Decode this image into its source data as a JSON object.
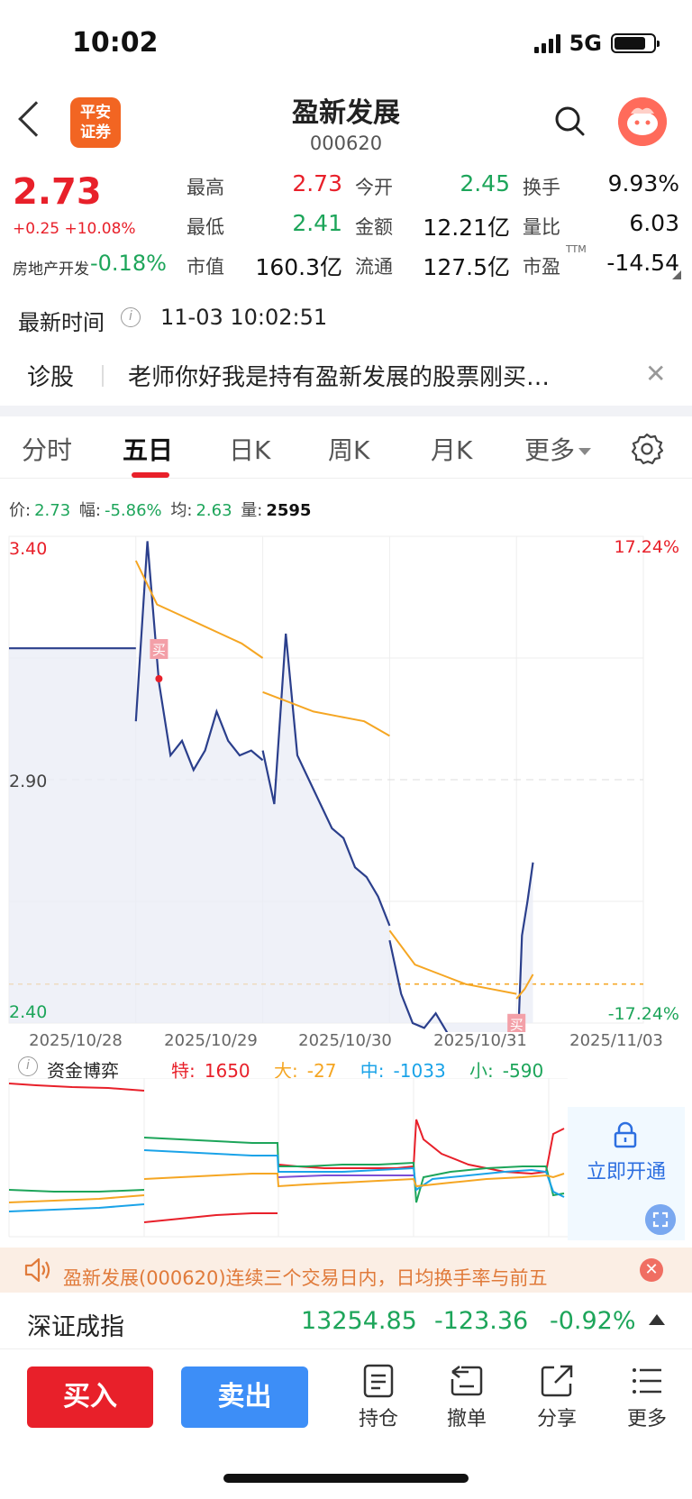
{
  "status_bar": {
    "time": "10:02",
    "network": "5G"
  },
  "header": {
    "logo_line1": "平安",
    "logo_line2": "证券",
    "stock_name": "盈新发展",
    "stock_code": "000620"
  },
  "quote": {
    "price": "2.73",
    "change": "+0.25 +10.08%",
    "sector_name": "房地产开发",
    "sector_change": "-0.18%",
    "fields": [
      {
        "label": "最高",
        "value": "2.73"
      },
      {
        "label": "今开",
        "value": "2.45"
      },
      {
        "label": "换手",
        "value": "9.93%"
      },
      {
        "label": "最低",
        "value": "2.41"
      },
      {
        "label": "金额",
        "value": "12.21亿"
      },
      {
        "label": "量比",
        "value": "6.03"
      },
      {
        "label": "市值",
        "value": "160.3亿"
      },
      {
        "label": "流通",
        "value": "127.5亿"
      },
      {
        "label": "市盈",
        "value": "-14.54",
        "superscript": "TTM"
      }
    ]
  },
  "latest": {
    "label": "最新时间",
    "time": "11-03 10:02:51"
  },
  "diagnosis": {
    "label": "诊股",
    "text": "老师你好我是持有盈新发展的股票刚买…"
  },
  "tabs": [
    {
      "label": "分时"
    },
    {
      "label": "五日"
    },
    {
      "label": "日K"
    },
    {
      "label": "周K"
    },
    {
      "label": "月K"
    },
    {
      "label": "更多"
    }
  ],
  "active_tab": "五日",
  "info_line": {
    "price_label": "价:",
    "price": "2.73",
    "range_label": "幅:",
    "range": "-5.86%",
    "avg_label": "均:",
    "avg": "2.63",
    "vol_label": "量:",
    "vol": "2595"
  },
  "chart_data": {
    "type": "line",
    "title": "",
    "x": [
      "2025/10/28",
      "2025/10/29",
      "2025/10/30",
      "2025/10/31",
      "2025/11/03"
    ],
    "ylim": [
      2.4,
      3.4
    ],
    "y_ticks": [
      "3.40",
      "2.90",
      "2.40"
    ],
    "pct_ticks": [
      "17.24%",
      "-17.24%"
    ],
    "reference_close": 2.48,
    "buy_marker_label": "买",
    "series": [
      {
        "values_by_day": [
          [
            3.17,
            3.17
          ],
          [
            3.02,
            3.39,
            3.1,
            2.95,
            2.98,
            2.92,
            2.96,
            3.04,
            2.98,
            2.95,
            2.96,
            2.94
          ],
          [
            2.96,
            2.85,
            3.2,
            2.95,
            2.9,
            2.85,
            2.8,
            2.78,
            2.72,
            2.7,
            2.66,
            2.6
          ],
          [
            2.57,
            2.46,
            2.4,
            2.39,
            2.42,
            2.38,
            2.37,
            2.36,
            2.35,
            2.33,
            2.34,
            2.33
          ],
          [
            2.28,
            2.58,
            2.65,
            2.73
          ]
        ]
      },
      {
        "values_by_day": [
          [],
          [
            3.35,
            3.26,
            3.24,
            3.22,
            3.2,
            3.18,
            3.15
          ],
          [
            3.08,
            3.06,
            3.04,
            3.03,
            3.02,
            2.99
          ],
          [
            2.59,
            2.52,
            2.5,
            2.48,
            2.47,
            2.46
          ],
          [
            2.45,
            2.47,
            2.5
          ]
        ]
      }
    ]
  },
  "fund_flow": {
    "title": "资金博弈",
    "items": [
      {
        "label": "特:",
        "value": "1650",
        "color": "#e8202a"
      },
      {
        "label": "大:",
        "value": "-27",
        "color": "#f5a623"
      },
      {
        "label": "中:",
        "value": "-1033",
        "color": "#1aa3e8"
      },
      {
        "label": "小:",
        "value": "-590",
        "color": "#1da55a"
      }
    ],
    "unlock_label": "立即开通"
  },
  "notice": {
    "text": "盈新发展(000620)连续三个交易日内，日均换手率与前五"
  },
  "index": {
    "name": "深证成指",
    "value": "13254.85",
    "change": "-123.36",
    "pct": "-0.92%"
  },
  "toolbar": {
    "buy": "买入",
    "sell": "卖出",
    "items": [
      {
        "label": "持仓",
        "icon": "holdings-icon"
      },
      {
        "label": "撤单",
        "icon": "cancel-order-icon"
      },
      {
        "label": "分享",
        "icon": "share-icon"
      },
      {
        "label": "更多",
        "icon": "more-menu-icon"
      }
    ]
  },
  "colors": {
    "up": "#e8202a",
    "down": "#1da55a",
    "price_line": "#2b3f8c",
    "avg_line": "#f5a623",
    "accent_blue": "#3d8ef7"
  }
}
